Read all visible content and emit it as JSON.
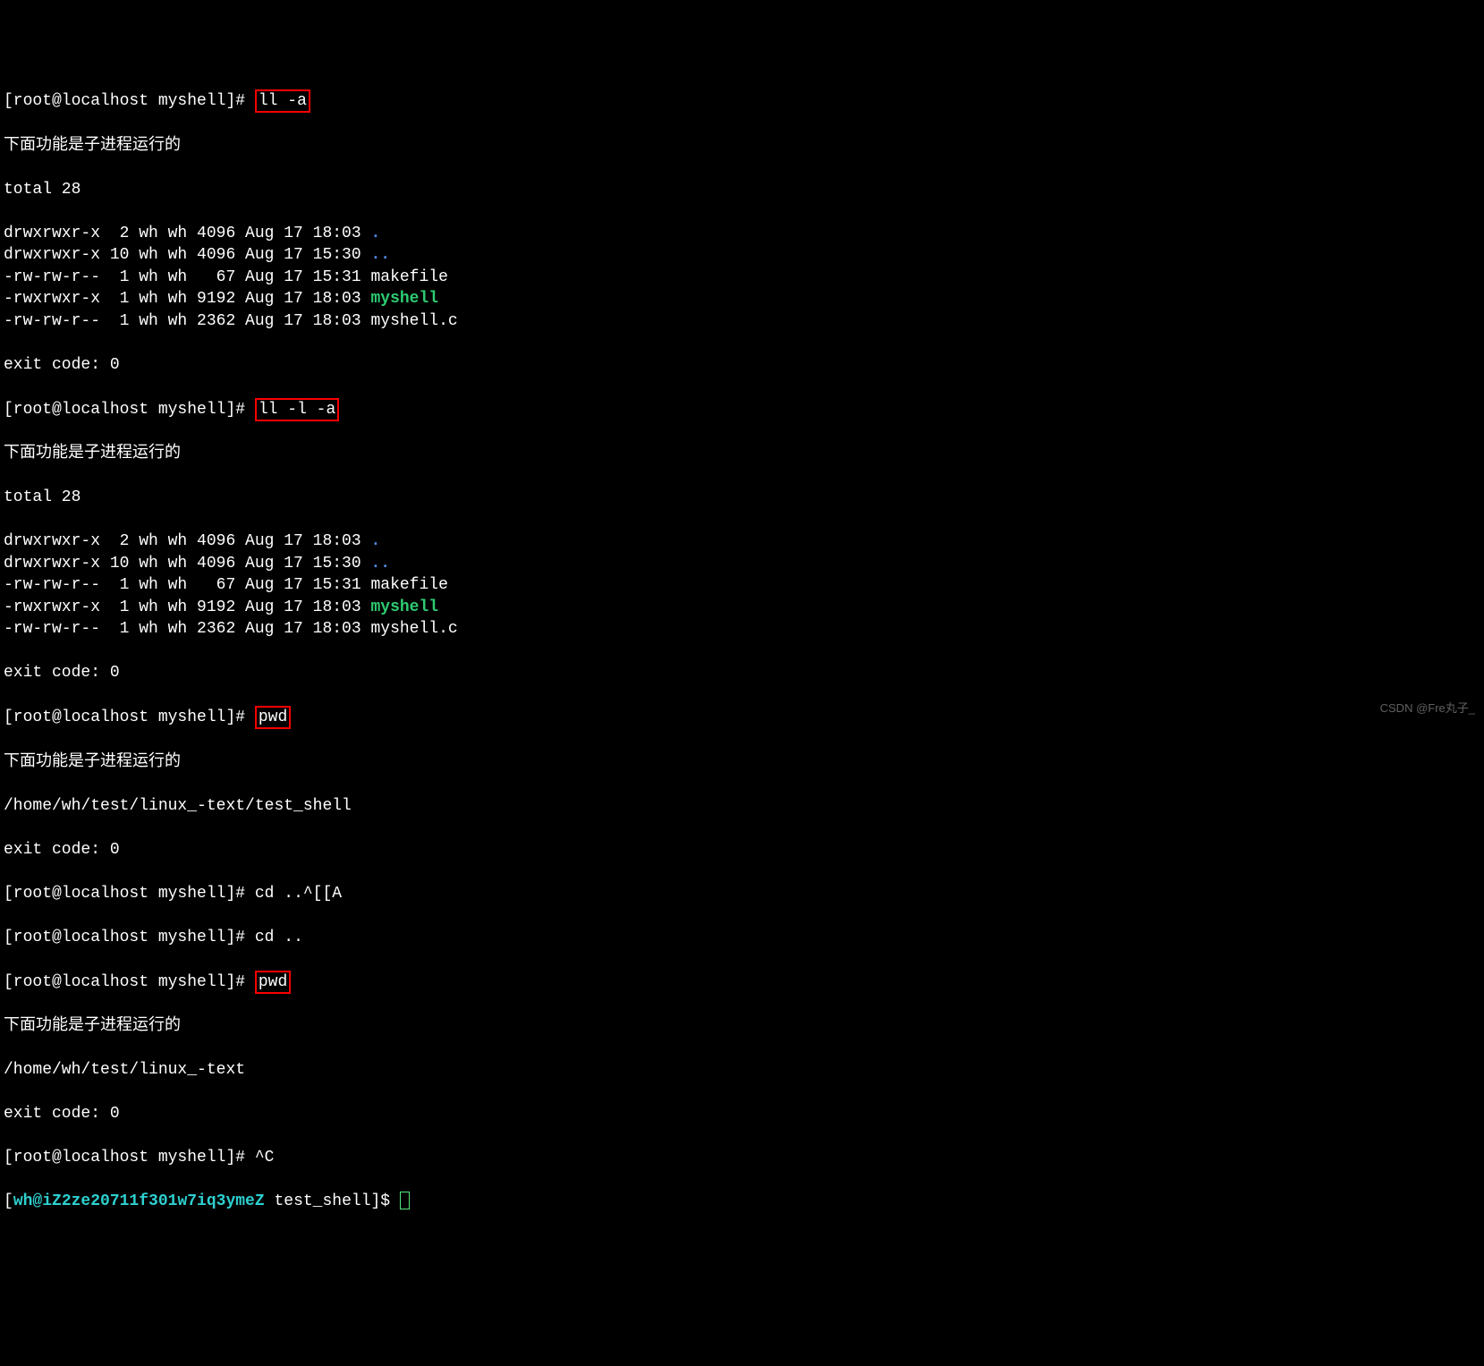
{
  "prompt": "[root@localhost myshell]# ",
  "cmd1": "ll -a",
  "child_msg": "下面功能是子进程运行的",
  "ls": {
    "total": "total 28",
    "rows": [
      {
        "perm": "drwxrwxr-x",
        "links": " 2",
        "own": "wh",
        "grp": "wh",
        "size": "4096",
        "date": "Aug 17 18:03",
        "name": ".",
        "cls": "blue"
      },
      {
        "perm": "drwxrwxr-x",
        "links": "10",
        "own": "wh",
        "grp": "wh",
        "size": "4096",
        "date": "Aug 17 15:30",
        "name": "..",
        "cls": "blue"
      },
      {
        "perm": "-rw-rw-r--",
        "links": " 1",
        "own": "wh",
        "grp": "wh",
        "size": "  67",
        "date": "Aug 17 15:31",
        "name": "makefile",
        "cls": ""
      },
      {
        "perm": "-rwxrwxr-x",
        "links": " 1",
        "own": "wh",
        "grp": "wh",
        "size": "9192",
        "date": "Aug 17 18:03",
        "name": "myshell",
        "cls": "green"
      },
      {
        "perm": "-rw-rw-r--",
        "links": " 1",
        "own": "wh",
        "grp": "wh",
        "size": "2362",
        "date": "Aug 17 18:03",
        "name": "myshell.c",
        "cls": ""
      }
    ]
  },
  "exit": "exit code: 0",
  "cmd2": "ll -l -a",
  "cmd3": "pwd",
  "pwd1_out": "/home/wh/test/linux_-text/test_shell",
  "cmd4": "cd ..^[[A",
  "cmd5": "cd ..",
  "cmd6": "pwd",
  "pwd2_out": "/home/wh/test/linux_-text",
  "cmd7": "^C",
  "prompt2_pre": "[",
  "prompt2_user": "wh@iZ2ze20711f301w7iq3ymeZ",
  "prompt2_mid": " test_shell]$ ",
  "watermark": "CSDN @Fre丸子_"
}
